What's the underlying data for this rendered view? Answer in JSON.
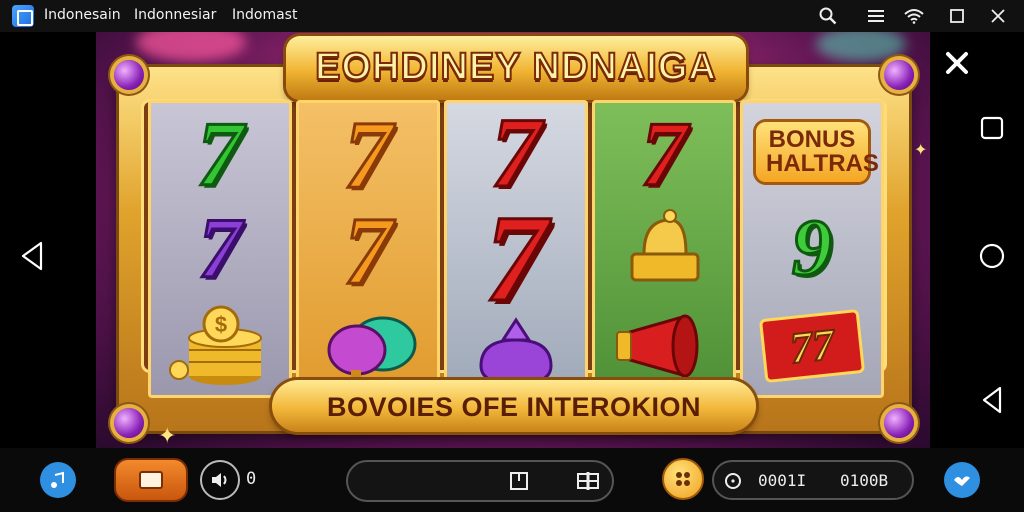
{
  "topbar": {
    "tabs": [
      "Indonesain",
      "Indonnesiar",
      "Indomast"
    ],
    "icons": [
      "search-icon",
      "more-icon",
      "wifi-icon",
      "maximize-icon",
      "close-icon"
    ]
  },
  "game": {
    "title": "EOHDINEY NDNAIGA",
    "banner": "BOVOIES OFE INTEROKION",
    "reels": [
      [
        {
          "type": "seven",
          "text": "7",
          "color": "#34c534"
        },
        {
          "type": "seven",
          "text": "7",
          "color": "#8b3fd6"
        },
        {
          "type": "coins",
          "icon": "coin-stack-icon"
        }
      ],
      [
        {
          "type": "seven",
          "text": "7",
          "color": "#f59a1e"
        },
        {
          "type": "seven",
          "text": "7",
          "color": "#f59a1e"
        },
        {
          "type": "pouch",
          "icon": "pouch-icon",
          "color": "#2fc9a0"
        }
      ],
      [
        {
          "type": "seven",
          "text": "7",
          "color": "#e01f1f"
        },
        {
          "type": "seven",
          "text": "7",
          "color": "#e01f1f"
        },
        {
          "type": "pouch",
          "icon": "pouch-icon",
          "color": "#9a45d8"
        }
      ],
      [
        {
          "type": "seven",
          "text": "7",
          "color": "#e01f1f"
        },
        {
          "type": "bell",
          "icon": "bell-icon"
        },
        {
          "type": "horn",
          "icon": "horn-icon"
        }
      ],
      [
        {
          "type": "bonus",
          "text": "BONUS HALTRAS"
        },
        {
          "type": "seven",
          "text": "9",
          "color": "#3fcc3a"
        },
        {
          "type": "ticket",
          "text": "77"
        }
      ]
    ]
  },
  "controls": {
    "sound_value": "0",
    "counter_left": "0001I",
    "counter_right": "0100B"
  },
  "colors": {
    "frame_gold": "#e0a32c",
    "background_magenta": "#b0307e"
  }
}
